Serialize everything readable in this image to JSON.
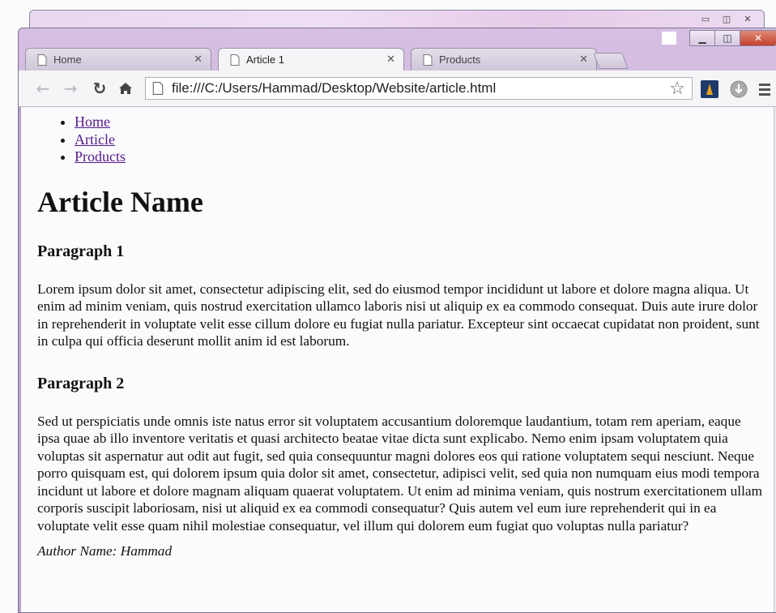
{
  "browser": {
    "tabs": [
      {
        "label": "Home",
        "active": false
      },
      {
        "label": "Article 1",
        "active": true
      },
      {
        "label": "Products",
        "active": false
      }
    ],
    "address": "file:///C:/Users/Hammad/Desktop/Website/article.html",
    "icons": [
      "back-icon",
      "forward-icon",
      "reload-icon",
      "home-icon",
      "bookmark-star-icon",
      "extension-icon",
      "download-icon",
      "menu-icon"
    ]
  },
  "page": {
    "nav": [
      "Home",
      "Article",
      "Products"
    ],
    "title": "Article Name",
    "sections": [
      {
        "heading": "Paragraph 1",
        "text": "Lorem ipsum dolor sit amet, consectetur adipiscing elit, sed do eiusmod tempor incididunt ut labore et dolore magna aliqua. Ut enim ad minim veniam, quis nostrud exercitation ullamco laboris nisi ut aliquip ex ea commodo consequat. Duis aute irure dolor in reprehenderit in voluptate velit esse cillum dolore eu fugiat nulla pariatur. Excepteur sint occaecat cupidatat non proident, sunt in culpa qui officia deserunt mollit anim id est laborum."
      },
      {
        "heading": "Paragraph 2",
        "text": "Sed ut perspiciatis unde omnis iste natus error sit voluptatem accusantium doloremque laudantium, totam rem aperiam, eaque ipsa quae ab illo inventore veritatis et quasi architecto beatae vitae dicta sunt explicabo. Nemo enim ipsam voluptatem quia voluptas sit aspernatur aut odit aut fugit, sed quia consequuntur magni dolores eos qui ratione voluptatem sequi nesciunt. Neque porro quisquam est, qui dolorem ipsum quia dolor sit amet, consectetur, adipisci velit, sed quia non numquam eius modi tempora incidunt ut labore et dolore magnam aliquam quaerat voluptatem. Ut enim ad minima veniam, quis nostrum exercitationem ullam corporis suscipit laboriosam, nisi ut aliquid ex ea commodi consequatur? Quis autem vel eum iure reprehenderit qui in ea voluptate velit esse quam nihil molestiae consequatur, vel illum qui dolorem eum fugiat quo voluptas nulla pariatur?"
      }
    ],
    "author": "Author Name: Hammad"
  }
}
